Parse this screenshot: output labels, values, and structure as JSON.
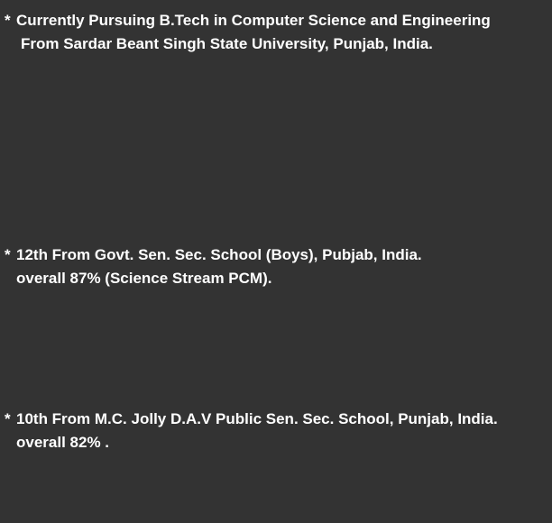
{
  "education": [
    {
      "bullet": "*",
      "line1": "Currently Pursuing B.Tech in Computer Science and Engineering",
      "line2": "From Sardar Beant Singh State University, Punjab, India."
    },
    {
      "bullet": "*",
      "line1": "12th From Govt. Sen. Sec. School (Boys), Pubjab, India.",
      "line2": "overall 87% (Science Stream PCM)."
    },
    {
      "bullet": "*",
      "line1": "10th From M.C. Jolly D.A.V Public Sen. Sec. School, Punjab, India.",
      "line2": "overall 82% ."
    }
  ]
}
